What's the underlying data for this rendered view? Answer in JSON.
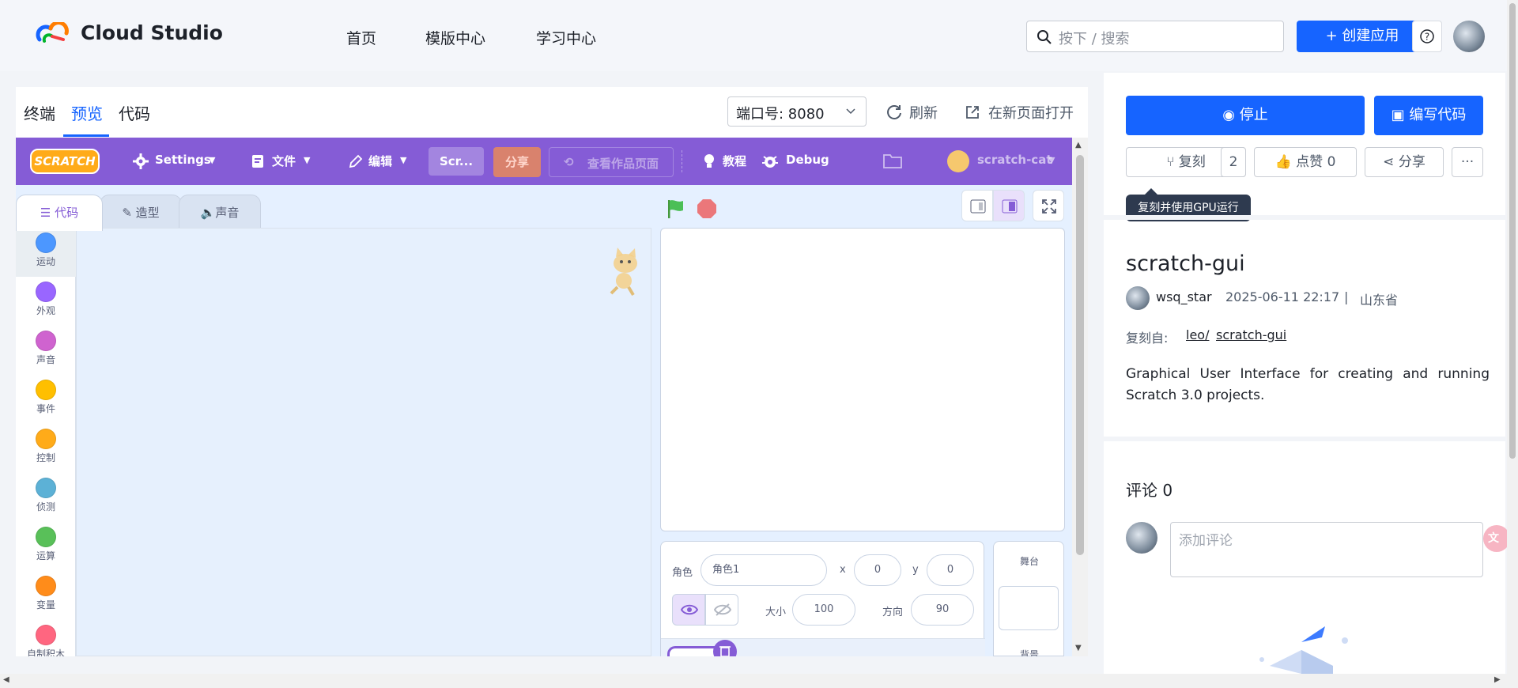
{
  "header": {
    "brand": "Cloud Studio",
    "nav": [
      "首页",
      "模版中心",
      "学习中心"
    ],
    "search_placeholder": "按下 / 搜索",
    "create_label": "+ 创建应用",
    "help_glyph": "?"
  },
  "workspace": {
    "tabs": [
      "终端",
      "预览",
      "代码"
    ],
    "active_tab": "预览",
    "port_label": "端口号: 8080",
    "refresh_label": "刷新",
    "open_new_label": "在新页面打开"
  },
  "scratch": {
    "logo": "SCRATCH",
    "menu": {
      "settings": "Settings",
      "file": "文件",
      "edit": "编辑",
      "project_title": "Scr...",
      "share": "分享",
      "see_project": "查看作品页面",
      "tutorials": "教程",
      "debug": "Debug",
      "username": "scratch-cat"
    },
    "tabs": [
      "代码",
      "造型",
      "声音"
    ],
    "categories": [
      {
        "label": "运动",
        "color": "#4c97ff"
      },
      {
        "label": "外观",
        "color": "#9966ff"
      },
      {
        "label": "声音",
        "color": "#cf63cf"
      },
      {
        "label": "事件",
        "color": "#ffbf00"
      },
      {
        "label": "控制",
        "color": "#ffab19"
      },
      {
        "label": "侦测",
        "color": "#5cb1d6"
      },
      {
        "label": "运算",
        "color": "#59c059"
      },
      {
        "label": "变量",
        "color": "#ff8c1a"
      },
      {
        "label": "自制积木",
        "color": "#ff6680"
      }
    ],
    "sprite_info": {
      "sprite_label": "角色",
      "sprite_name": "角色1",
      "x_label": "x",
      "x_value": "0",
      "y_label": "y",
      "y_value": "0",
      "size_label": "大小",
      "size_value": "100",
      "direction_label": "方向",
      "direction_value": "90"
    },
    "stage_panel": {
      "title": "舞台",
      "backdrop_label": "背景"
    }
  },
  "sidebar": {
    "stop_label": "停止",
    "edit_code_label": "编写代码",
    "fork_label": "复刻",
    "fork_count": "2",
    "like_label": "点赞 0",
    "share_label": "分享",
    "more_glyph": "···",
    "tooltip": "复刻并使用GPU运行",
    "project_name": "scratch-gui",
    "author": "wsq_star",
    "date": "2025-06-11 22:17",
    "divider": "|",
    "location": "山东省",
    "forked_from_label": "复刻自:",
    "forked_user": "leo/",
    "forked_repo": "scratch-gui",
    "description": "Graphical User Interface for creating and running Scratch 3.0 projects.",
    "comments_title": "评论 0",
    "comment_placeholder": "添加评论"
  },
  "colors": {
    "accent": "#1664ff",
    "scratch_purple": "#855cd6",
    "scratch_blue_bg": "#e5f0ff"
  }
}
